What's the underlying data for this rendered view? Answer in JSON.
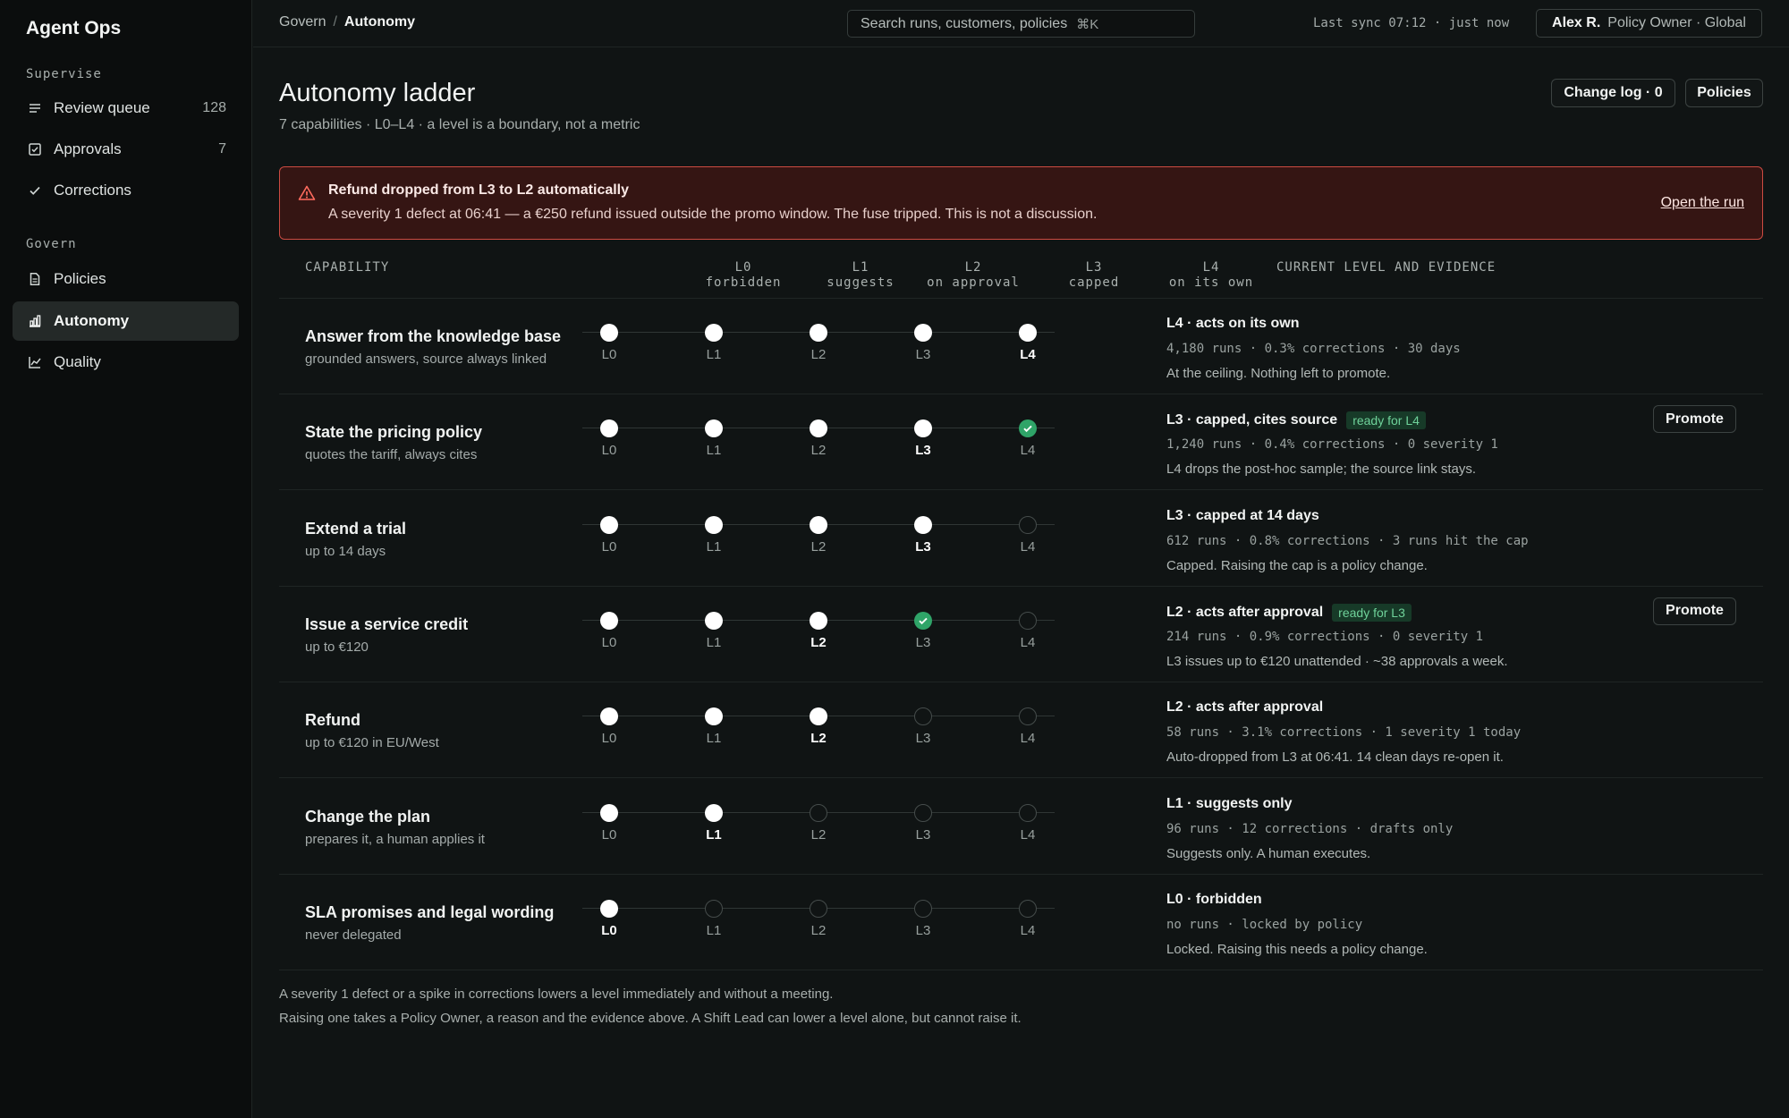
{
  "sidebar": {
    "brand": "Agent Ops",
    "sections": [
      {
        "label": "Supervise",
        "items": [
          {
            "label": "Review queue",
            "count": "128",
            "icon": "list-icon"
          },
          {
            "label": "Approvals",
            "count": "7",
            "icon": "checkbox-icon"
          },
          {
            "label": "Corrections",
            "count": "",
            "icon": "check-icon"
          }
        ]
      },
      {
        "label": "Govern",
        "items": [
          {
            "label": "Policies",
            "count": "",
            "icon": "document-icon"
          },
          {
            "label": "Autonomy",
            "count": "",
            "icon": "bar-chart-icon",
            "active": true
          },
          {
            "label": "Quality",
            "count": "",
            "icon": "line-chart-icon"
          }
        ]
      }
    ]
  },
  "topbar": {
    "breadcrumb": [
      "Govern",
      "Autonomy"
    ],
    "search_placeholder": "Search runs, customers, policies",
    "search_shortcut": "⌘K",
    "sync": "Last sync 07:12 · just now",
    "user_name": "Alex R.",
    "user_role": "Policy Owner · Global"
  },
  "header": {
    "title": "Autonomy ladder",
    "subtitle": "7 capabilities · L0–L4 · a level is a boundary, not a metric",
    "change_log": "Change log · 0",
    "policies": "Policies"
  },
  "alert": {
    "title": "Refund dropped from L3 to L2 automatically",
    "body": "A severity 1 defect at 06:41 — a €250 refund issued outside the promo window. The fuse tripped. This is not a discussion.",
    "link": "Open the run",
    "color": "#cc4b42"
  },
  "table": {
    "columns": {
      "capability": "CAPABILITY",
      "levels": [
        {
          "code": "L0",
          "desc": "forbidden"
        },
        {
          "code": "L1",
          "desc": "suggests"
        },
        {
          "code": "L2",
          "desc": "on approval"
        },
        {
          "code": "L3",
          "desc": "capped"
        },
        {
          "code": "L4",
          "desc": "on its own"
        }
      ],
      "evidence": "CURRENT LEVEL AND EVIDENCE"
    },
    "level_labels": [
      "L0",
      "L1",
      "L2",
      "L3",
      "L4"
    ],
    "promote_label": "Promote",
    "rows": [
      {
        "name": "Answer from the knowledge base",
        "sub": "grounded answers, source always linked",
        "level": 4,
        "ready": null,
        "ev_title": "L4 · acts on its own",
        "badge": "",
        "stats": "4,180 runs · 0.3% corrections · 30 days",
        "note": "At the ceiling. Nothing left to promote.",
        "promote": false
      },
      {
        "name": "State the pricing policy",
        "sub": "quotes the tariff, always cites",
        "level": 3,
        "ready": 4,
        "ev_title": "L3 · capped, cites source",
        "badge": "ready for L4",
        "stats": "1,240 runs · 0.4% corrections · 0 severity 1",
        "note": "L4 drops the post-hoc sample; the source link stays.",
        "promote": true
      },
      {
        "name": "Extend a trial",
        "sub": "up to 14 days",
        "level": 3,
        "ready": null,
        "ev_title": "L3 · capped at 14 days",
        "badge": "",
        "stats": "612 runs · 0.8% corrections · 3 runs hit the cap",
        "note": "Capped. Raising the cap is a policy change.",
        "promote": false
      },
      {
        "name": "Issue a service credit",
        "sub": "up to €120",
        "level": 2,
        "ready": 3,
        "ev_title": "L2 · acts after approval",
        "badge": "ready for L3",
        "stats": "214 runs · 0.9% corrections · 0 severity 1",
        "note": "L3 issues up to €120 unattended · ~38 approvals a week.",
        "promote": true
      },
      {
        "name": "Refund",
        "sub": "up to €120 in EU/West",
        "level": 2,
        "ready": null,
        "ev_title": "L2 · acts after approval",
        "badge": "",
        "stats": "58 runs · 3.1% corrections · 1 severity 1 today",
        "note": "Auto-dropped from L3 at 06:41. 14 clean days re-open it.",
        "promote": false
      },
      {
        "name": "Change the plan",
        "sub": "prepares it, a human applies it",
        "level": 1,
        "ready": null,
        "ev_title": "L1 · suggests only",
        "badge": "",
        "stats": "96 runs · 12 corrections · drafts only",
        "note": "Suggests only. A human executes.",
        "promote": false
      },
      {
        "name": "SLA promises and legal wording",
        "sub": "never delegated",
        "level": 0,
        "ready": null,
        "ev_title": "L0 · forbidden",
        "badge": "",
        "stats": "no runs · locked by policy",
        "note": "Locked. Raising this needs a policy change.",
        "promote": false
      }
    ]
  },
  "footer": {
    "line1": "A severity 1 defect or a spike in corrections lowers a level immediately and without a meeting.",
    "line2": "Raising one takes a Policy Owner, a reason and the evidence above. A Shift Lead can lower a level alone, but cannot raise it."
  }
}
